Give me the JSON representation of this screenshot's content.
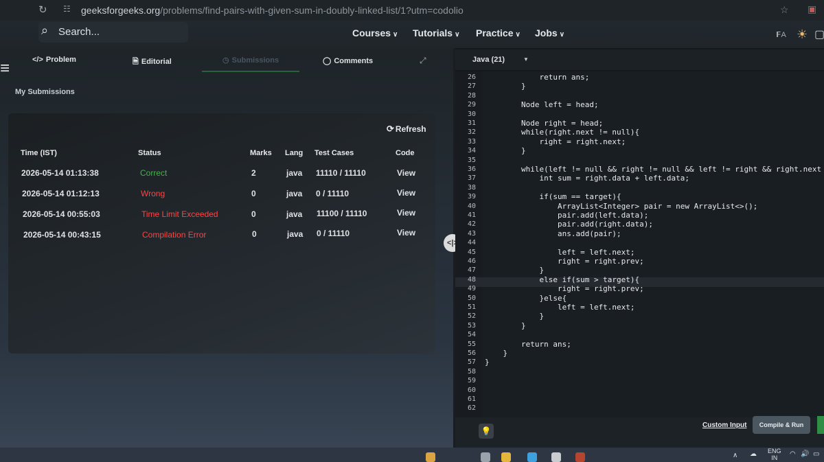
{
  "browser": {
    "url_host": "geeksforgeeks.org",
    "url_path": "/problems/find-pairs-with-given-sum-in-doubly-linked-list/1?utm=codolio"
  },
  "header": {
    "search_placeholder": "Search...",
    "nav": [
      "Courses",
      "Tutorials",
      "Practice",
      "Jobs"
    ]
  },
  "tabs": {
    "problem": "Problem",
    "editorial": "Editorial",
    "submissions": "Submissions",
    "comments": "Comments"
  },
  "submissions": {
    "title": "My Submissions",
    "refresh": "Refresh",
    "columns": [
      "Time (IST)",
      "Status",
      "Marks",
      "Lang",
      "Test Cases",
      "Code"
    ],
    "rows": [
      {
        "time": "2026-05-14 01:13:38",
        "status": "Correct",
        "status_color": "#4caf50",
        "marks": "2",
        "lang": "java",
        "tests": "11110 / 11110",
        "code": "View"
      },
      {
        "time": "2026-05-14 01:12:13",
        "status": "Wrong",
        "status_color": "#ff4444",
        "marks": "0",
        "lang": "java",
        "tests": "0 / 11110",
        "code": "View"
      },
      {
        "time": "2026-05-14 00:55:03",
        "status": "Time Limit Exceeded",
        "status_color": "#ff4444",
        "marks": "0",
        "lang": "java",
        "tests": "11100 / 11110",
        "code": "View"
      },
      {
        "time": "2026-05-14 00:43:15",
        "status": "Compilation Error",
        "status_color": "#ff4444",
        "marks": "0",
        "lang": "java",
        "tests": "0 / 11110",
        "code": "View"
      }
    ]
  },
  "editor": {
    "language": "Java (21)",
    "line_numbers": [
      "26",
      "27",
      "28",
      "29",
      "30",
      "31",
      "32",
      "33",
      "34",
      "35",
      "36",
      "37",
      "38",
      "39",
      "40",
      "41",
      "42",
      "43",
      "44",
      "45",
      "46",
      "47",
      "48",
      "49",
      "50",
      "51",
      "52",
      "53",
      "54",
      "55",
      "56",
      "57",
      "58",
      "59",
      "60",
      "61",
      "62"
    ],
    "code_lines": [
      "            return ans;",
      "        }",
      "",
      "        Node left = head;",
      "",
      "        Node right = head;",
      "        while(right.next != null){",
      "            right = right.next;",
      "        }",
      "",
      "        while(left != null && right != null && left != right && right.next !=",
      "            int sum = right.data + left.data;",
      "",
      "            if(sum == target){",
      "                ArrayList<Integer> pair = new ArrayList<>();",
      "                pair.add(left.data);",
      "                pair.add(right.data);",
      "                ans.add(pair);",
      "",
      "                left = left.next;",
      "                right = right.prev;",
      "            }",
      "            else if(sum > target){",
      "                right = right.prev;",
      "            }else{",
      "                left = left.next;",
      "            }",
      "        }",
      "",
      "        return ans;",
      "    }",
      "}",
      "",
      "",
      "",
      "",
      ""
    ],
    "custom_input": "Custom Input",
    "compile_run": "Compile & Run"
  },
  "taskbar": {
    "lang_top": "ENG",
    "lang_bottom": "IN"
  }
}
